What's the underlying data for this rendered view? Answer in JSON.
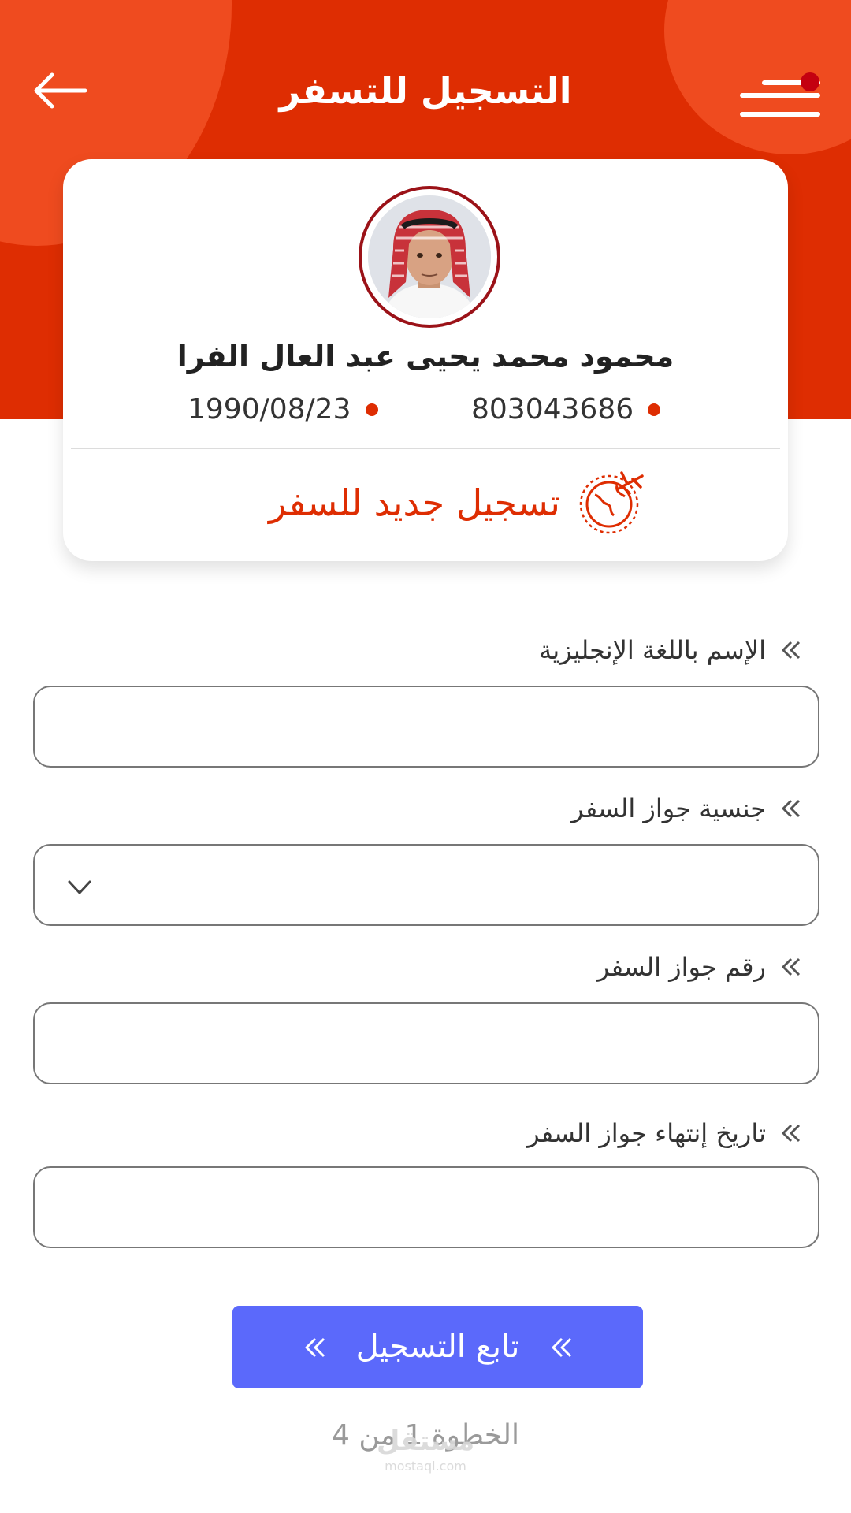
{
  "header": {
    "title": "التسجيل للتسفر",
    "back_icon": "arrow-left-icon",
    "menu_icon": "hamburger-menu-icon",
    "notification_color": "#c40010",
    "background_color": "#de2d02"
  },
  "profile": {
    "name": "محمود محمد يحيى عبد العال الفرا",
    "id_number": "803043686",
    "birth_date": "1990/08/23",
    "action_label": "تسجيل جديد للسفر",
    "action_icon": "globe-plane-icon"
  },
  "form": {
    "fields": [
      {
        "label": "الإسم باللغة الإنجليزية",
        "value": "",
        "type": "text"
      },
      {
        "label": "جنسية جواز السفر",
        "value": "",
        "type": "select"
      },
      {
        "label": "رقم جواز السفر",
        "value": "",
        "type": "text"
      },
      {
        "label": "تاريخ إنتهاء جواز السفر",
        "value": "",
        "type": "date"
      }
    ]
  },
  "actions": {
    "continue_label": "تابع التسجيل",
    "continue_color": "#5b69fb"
  },
  "progress": {
    "step_text": "الخطوة 1 من 4",
    "current_step": 1,
    "total_steps": 4
  },
  "watermark": {
    "arabic": "مستقل",
    "latin": "mostaql.com"
  }
}
